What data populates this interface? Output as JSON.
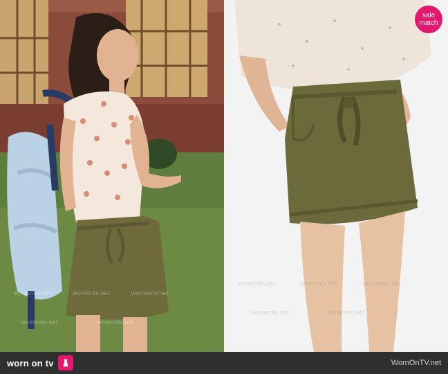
{
  "left_panel": {
    "watermarks": [
      "womontv.net",
      "womontv.net",
      "womontv.net",
      "womontv.net",
      "womontv.net"
    ]
  },
  "right_panel": {
    "badge_text": "sale\nmatch",
    "watermarks": [
      "womontv.net",
      "womontv.net",
      "womontv.net",
      "womontv.net",
      "womontv.net"
    ]
  },
  "footer": {
    "logo_text": "worn on tv",
    "site": "WornOnTV.net"
  },
  "colors": {
    "brand_pink": "#e2186f",
    "footer_bg": "#2f2f2f"
  },
  "icons": {
    "footer_logo": "dress-icon"
  }
}
